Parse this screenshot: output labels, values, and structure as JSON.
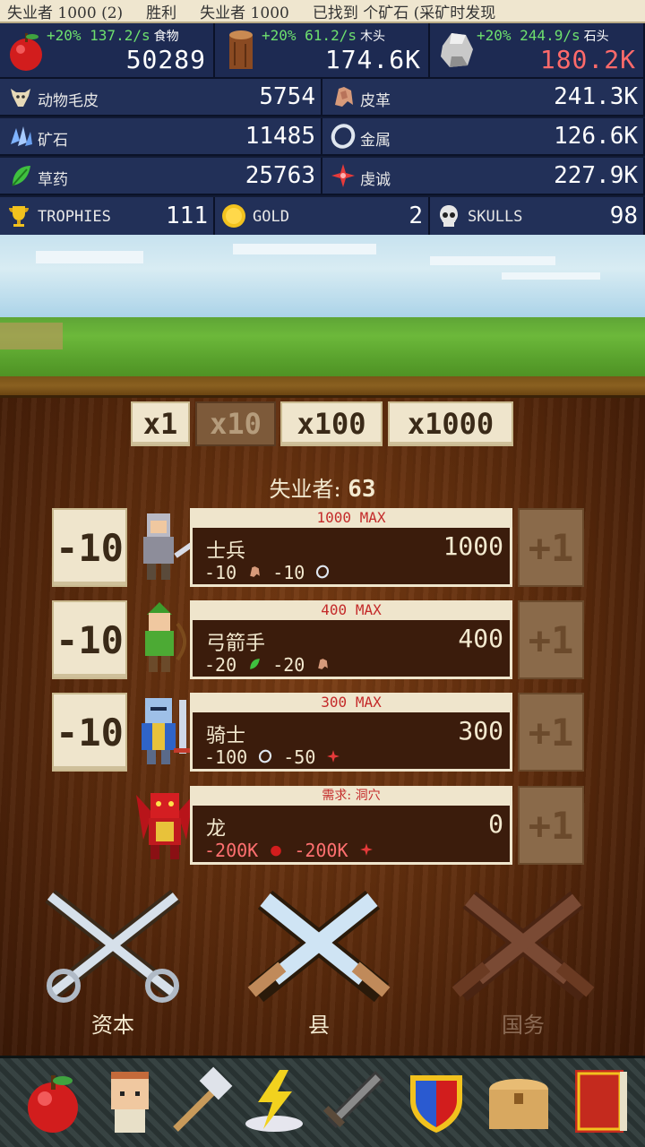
{
  "status_bar": {
    "items": [
      "失业者 1000 (2)",
      "胜利",
      "失业者 1000",
      "已找到 个矿石 (采矿时发现"
    ]
  },
  "production": [
    {
      "icon": "apple-icon",
      "rate": "+20% 137.2/s",
      "name": "食物",
      "amount": "50289",
      "amount_color": "#ffffff"
    },
    {
      "icon": "wood-log-icon",
      "rate": "+20% 61.2/s",
      "name": "木头",
      "amount": "174.6K",
      "amount_color": "#ffffff"
    },
    {
      "icon": "stone-icon",
      "rate": "+20% 244.9/s",
      "name": "石头",
      "amount": "180.2K",
      "amount_color": "#ff6a6a"
    }
  ],
  "resources": [
    {
      "icon": "animal-hide-icon",
      "label": "动物毛皮",
      "value": "5754"
    },
    {
      "icon": "leather-icon",
      "label": "皮革",
      "value": "241.3K"
    },
    {
      "icon": "ore-icon",
      "label": "矿石",
      "value": "11485"
    },
    {
      "icon": "metal-ring-icon",
      "label": "金属",
      "value": "126.6K"
    },
    {
      "icon": "herb-icon",
      "label": "草药",
      "value": "25763"
    },
    {
      "icon": "faith-icon",
      "label": "虔诚",
      "value": "227.9K"
    }
  ],
  "currencies": [
    {
      "icon": "trophy-icon",
      "label": "TROPHIES",
      "value": "111"
    },
    {
      "icon": "gold-coin-icon",
      "label": "GOLD",
      "value": "2"
    },
    {
      "icon": "skull-icon",
      "label": "SKULLS",
      "value": "98"
    }
  ],
  "multipliers": {
    "items": [
      "x1",
      "x10",
      "x100",
      "x1000"
    ],
    "active": "x10"
  },
  "idle": {
    "label": "失业者:",
    "value": "63"
  },
  "units": [
    {
      "name": "士兵",
      "top": "1000 MAX",
      "count": "1000",
      "minus": "-10",
      "plus": "+1",
      "cost1": "-10",
      "cost1_icon": "leather-icon",
      "cost2": "-10",
      "cost2_icon": "metal-ring-icon",
      "locked": false
    },
    {
      "name": "弓箭手",
      "top": "400 MAX",
      "count": "400",
      "minus": "-10",
      "plus": "+1",
      "cost1": "-20",
      "cost1_icon": "herb-icon",
      "cost2": "-20",
      "cost2_icon": "leather-icon",
      "locked": false
    },
    {
      "name": "骑士",
      "top": "300 MAX",
      "count": "300",
      "minus": "-10",
      "plus": "+1",
      "cost1": "-100",
      "cost1_icon": "metal-ring-icon",
      "cost2": "-50",
      "cost2_icon": "faith-icon",
      "locked": false
    },
    {
      "name": "龙",
      "top": "需求: 洞穴",
      "count": "0",
      "minus": "",
      "plus": "+1",
      "cost1": "-200K",
      "cost1_icon": "apple-icon",
      "cost2": "-200K",
      "cost2_icon": "faith-icon",
      "locked": true
    }
  ],
  "nav": [
    {
      "label": "资本",
      "enabled": true
    },
    {
      "label": "县",
      "enabled": true
    },
    {
      "label": "国务",
      "enabled": false
    }
  ],
  "toolbar": {
    "icons": [
      "apple-icon",
      "villager-icon",
      "hammer-icon",
      "lightning-icon",
      "sword-icon",
      "shield-icon",
      "chest-icon",
      "book-icon"
    ]
  },
  "colors": {
    "rate_green": "#6ee06e",
    "warning_red": "#ff6a6a",
    "panel_navy": "#1d2a52",
    "button_cream": "#efe5cc",
    "wood_brown": "#5a2a0c"
  }
}
